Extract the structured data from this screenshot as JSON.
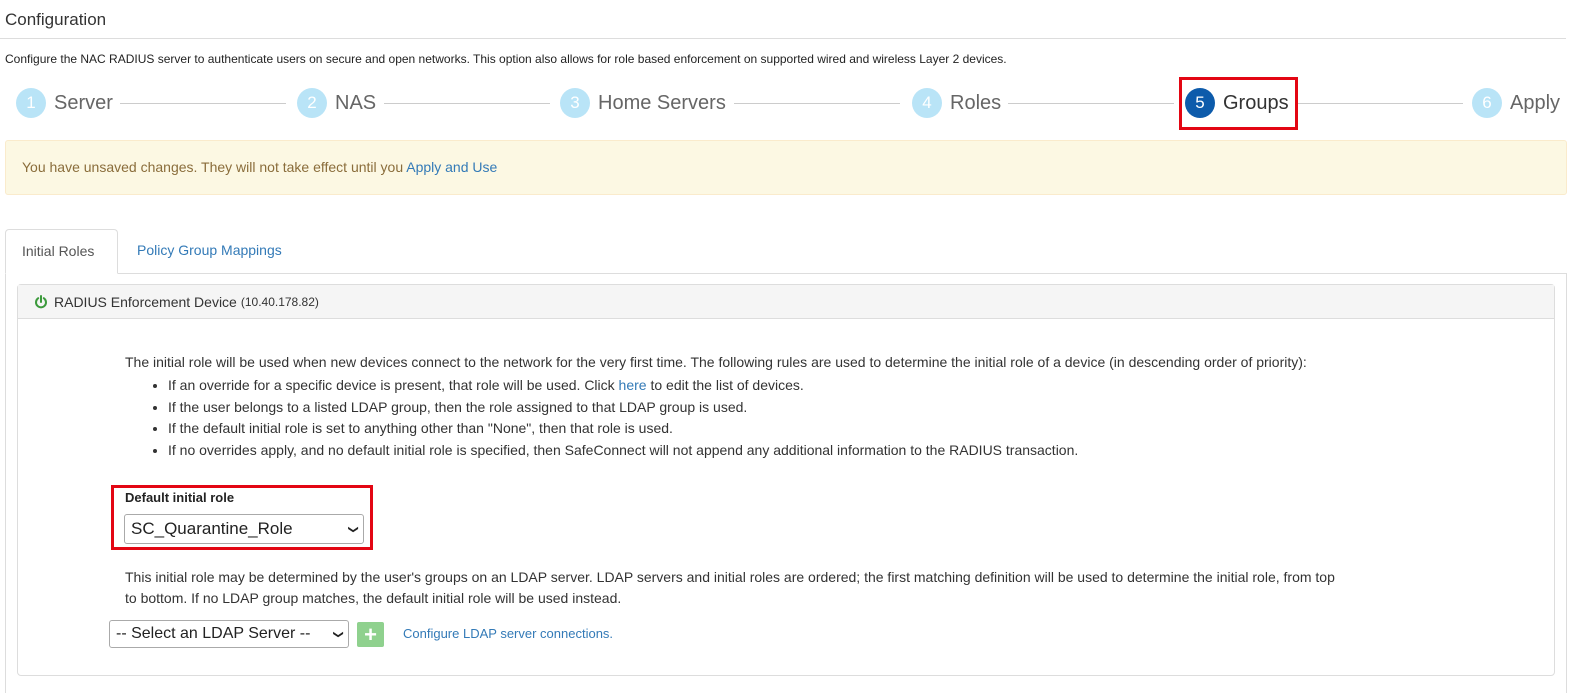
{
  "page": {
    "title": "Configuration",
    "description": "Configure the NAC RADIUS server to authenticate users on secure and open networks. This option also allows for role based enforcement on supported wired and wireless Layer 2 devices."
  },
  "wizard": {
    "steps": [
      {
        "number": "1",
        "label": "Server",
        "active": false
      },
      {
        "number": "2",
        "label": "NAS",
        "active": false
      },
      {
        "number": "3",
        "label": "Home Servers",
        "active": false
      },
      {
        "number": "4",
        "label": "Roles",
        "active": false
      },
      {
        "number": "5",
        "label": "Groups",
        "active": true
      },
      {
        "number": "6",
        "label": "Apply",
        "active": false
      }
    ]
  },
  "alert": {
    "message": "You have unsaved changes. They will not take effect until you ",
    "link_label": "Apply and Use"
  },
  "tabs": [
    {
      "label": "Initial Roles",
      "active": true
    },
    {
      "label": "Policy Group Mappings",
      "active": false
    }
  ],
  "panel": {
    "heading": "RADIUS Enforcement Device",
    "device_ip": "(10.40.178.82)",
    "icon": "power-icon",
    "icon_color": "#3c9a3c",
    "intro": "The initial role will be used when new devices connect to the network for the very first time. The following rules are used to determine the initial role of a device (in descending order of priority):",
    "rules": {
      "rule1_before": "If an override for a specific device is present, that role will be used. Click ",
      "rule1_link": "here",
      "rule1_after": " to edit the list of devices.",
      "rule2": "If the user belongs to a listed LDAP group, then the role assigned to that LDAP group is used.",
      "rule3": "If the default initial role is set to anything other than \"None\", then that role is used.",
      "rule4": "If no overrides apply, and no default initial role is specified, then SafeConnect will not append any additional information to the RADIUS transaction."
    },
    "default_role": {
      "label": "Default initial role",
      "selected": "SC_Quarantine_Role"
    },
    "ldap_text_line1": "This initial role may be determined by the user's groups on an LDAP server. LDAP servers and initial roles are ordered; the first matching definition will be used to determine the initial role, from top",
    "ldap_text_line2": "to bottom. If no LDAP group matches, the default initial role will be used instead.",
    "ldap_select": {
      "selected": "-- Select an LDAP Server --"
    },
    "add_button": "+",
    "ldap_link": "Configure LDAP server connections."
  },
  "colors": {
    "highlight": "#e30613",
    "active_step": "#0d5bab",
    "inactive_step": "#b9e4f7",
    "link": "#337ab7"
  }
}
